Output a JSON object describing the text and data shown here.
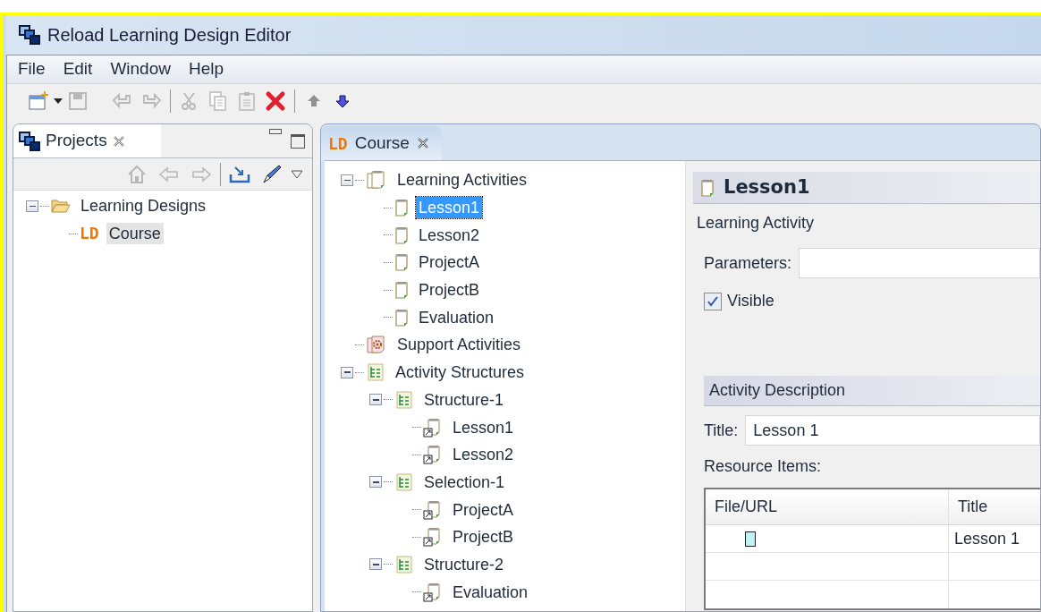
{
  "window": {
    "title": "Reload Learning Design Editor"
  },
  "menu": [
    "File",
    "Edit",
    "Window",
    "Help"
  ],
  "projects_view": {
    "tab": "Projects",
    "tree": [
      {
        "label": "Learning Designs",
        "kind": "folder",
        "expanded": true,
        "selected": false,
        "children": [
          {
            "label": "Course",
            "kind": "ld",
            "badge": "LD",
            "selected": false,
            "highlighted": true
          }
        ]
      }
    ]
  },
  "editor": {
    "tab_badge": "LD",
    "tab": "Course",
    "tree": [
      {
        "label": "Learning Activities",
        "kind": "activities",
        "expanded": true,
        "selected": false,
        "children": [
          {
            "label": "Lesson1",
            "kind": "activity",
            "selected": true
          },
          {
            "label": "Lesson2",
            "kind": "activity",
            "selected": false
          },
          {
            "label": "ProjectA",
            "kind": "activity",
            "selected": false
          },
          {
            "label": "ProjectB",
            "kind": "activity",
            "selected": false
          },
          {
            "label": "Evaluation",
            "kind": "activity",
            "selected": false
          }
        ]
      },
      {
        "label": "Support Activities",
        "kind": "support",
        "selected": false
      },
      {
        "label": "Activity Structures",
        "kind": "structures",
        "expanded": true,
        "selected": false,
        "children": [
          {
            "label": "Structure-1",
            "kind": "structure",
            "expanded": true,
            "selected": false,
            "children": [
              {
                "label": "Lesson1",
                "kind": "ref",
                "selected": false
              },
              {
                "label": "Lesson2",
                "kind": "ref",
                "selected": false
              }
            ]
          },
          {
            "label": "Selection-1",
            "kind": "structure",
            "expanded": true,
            "selected": false,
            "children": [
              {
                "label": "ProjectA",
                "kind": "ref",
                "selected": false
              },
              {
                "label": "ProjectB",
                "kind": "ref",
                "selected": false
              }
            ]
          },
          {
            "label": "Structure-2",
            "kind": "structure",
            "expanded": true,
            "selected": false,
            "children": [
              {
                "label": "Evaluation",
                "kind": "ref",
                "selected": false
              }
            ]
          }
        ]
      }
    ],
    "details": {
      "title": "Lesson1",
      "subtitle": "Learning Activity",
      "parameters_label": "Parameters:",
      "visible": {
        "label": "Visible",
        "checked": true
      },
      "section": "Activity Description",
      "title_label": "Title:",
      "title_value": "Lesson 1",
      "resources_label": "Resource Items:",
      "table": {
        "columns": [
          "File/URL",
          "Title"
        ],
        "rows": [
          {
            "title": "Lesson 1"
          }
        ]
      }
    }
  }
}
